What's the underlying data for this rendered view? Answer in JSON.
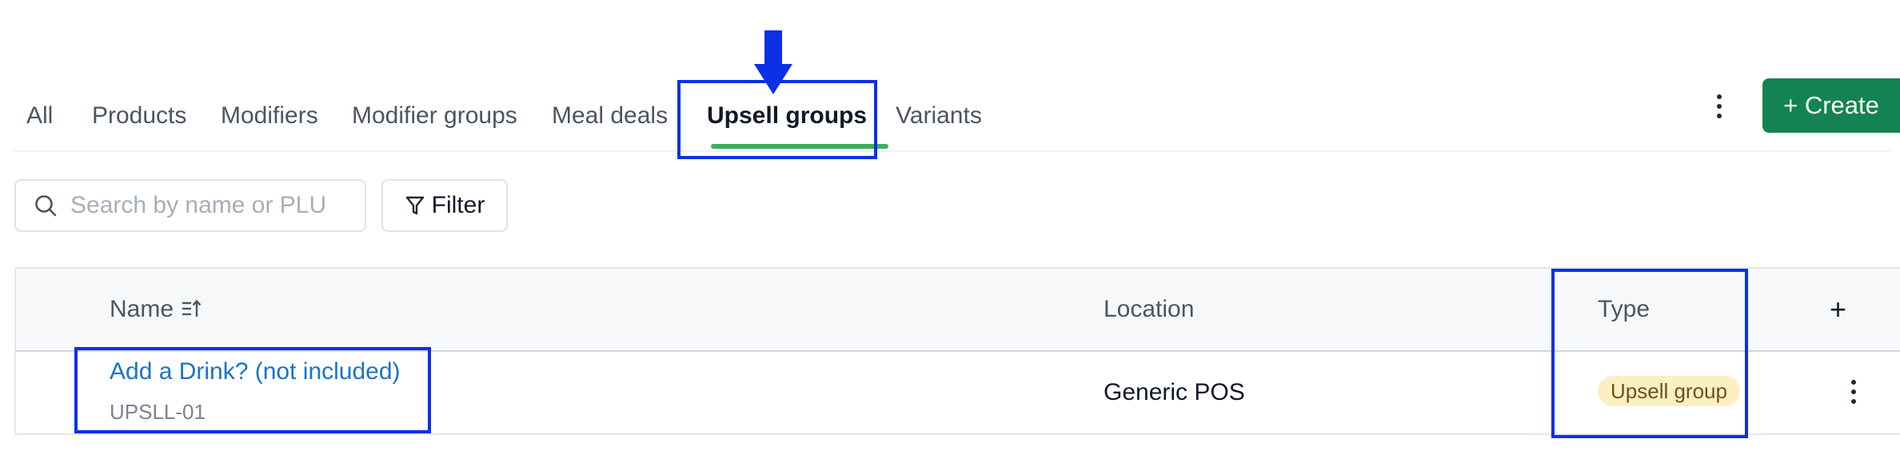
{
  "tabs": [
    {
      "label": "All",
      "active": false
    },
    {
      "label": "Products",
      "active": false
    },
    {
      "label": "Modifiers",
      "active": false
    },
    {
      "label": "Modifier groups",
      "active": false
    },
    {
      "label": "Meal deals",
      "active": false
    },
    {
      "label": "Upsell groups",
      "active": true
    },
    {
      "label": "Variants",
      "active": false
    }
  ],
  "toolbar": {
    "create_label": "+ Create",
    "search_placeholder": "Search by name or PLU",
    "filter_label": "Filter"
  },
  "table": {
    "columns": {
      "name": "Name",
      "location": "Location",
      "type": "Type"
    },
    "rows": [
      {
        "name": "Add a Drink? (not included)",
        "code": "UPSLL-01",
        "location": "Generic POS",
        "type": "Upsell group"
      }
    ]
  },
  "colors": {
    "accent": "#138451",
    "active_tab_underline": "#3bb05b",
    "highlight": "#0b30e6",
    "link": "#1a73c9",
    "badge_bg": "#fbf0c4"
  }
}
